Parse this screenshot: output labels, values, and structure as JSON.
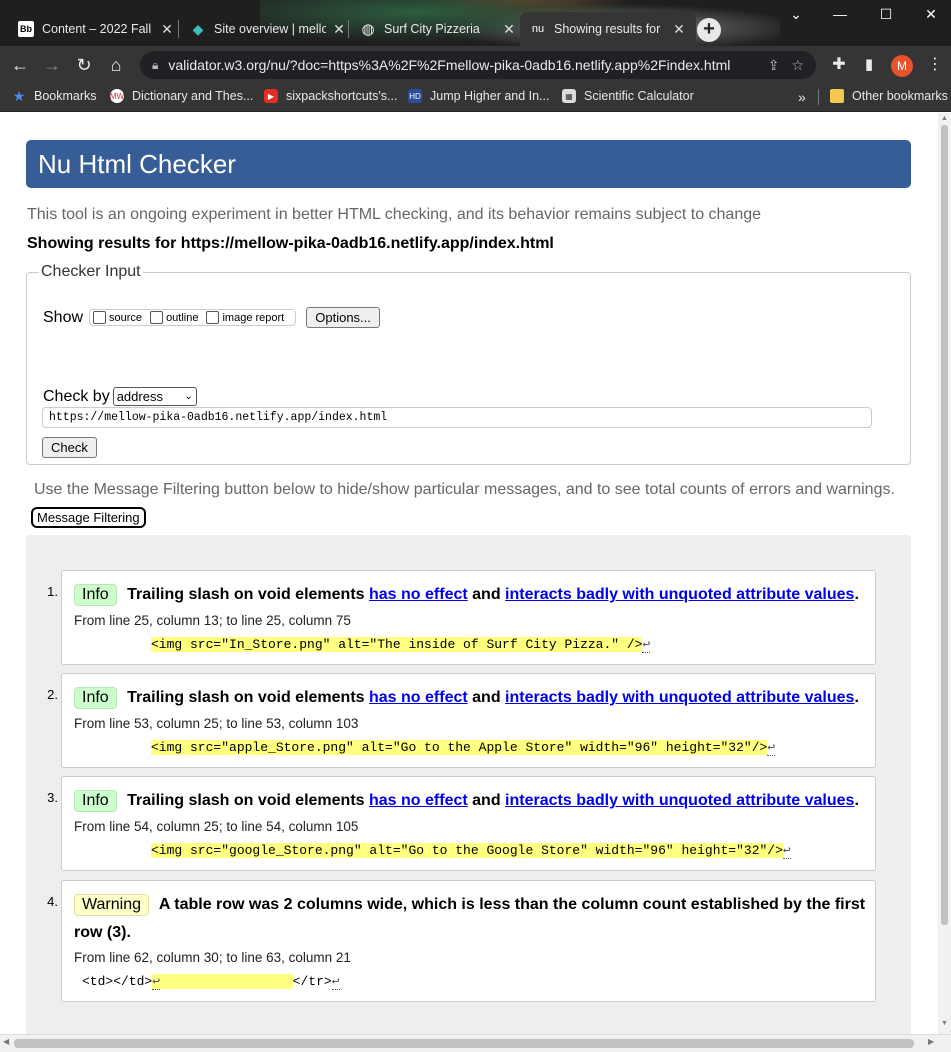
{
  "browser": {
    "tabs": [
      {
        "icon": "Bb",
        "label": "Content – 2022 Fall",
        "close": "✕"
      },
      {
        "icon": "◆",
        "label": "Site overview | mellow",
        "close": "✕"
      },
      {
        "icon": "◍",
        "label": "Surf City Pizzeria",
        "close": "✕"
      },
      {
        "icon": "nu",
        "label": "Showing results for",
        "close": "✕"
      }
    ],
    "new_tab": "+",
    "window_controls": [
      "⌄",
      "—",
      "☐",
      "✕"
    ],
    "url": "validator.w3.org/nu/?doc=https%3A%2F%2Fmellow-pika-0adb16.netlify.app%2Findex.html",
    "profile_initial": "M",
    "bookmarks": [
      {
        "label": "Bookmarks"
      },
      {
        "label": "Dictionary and Thes..."
      },
      {
        "label": "sixpackshortcuts's..."
      },
      {
        "label": "Jump Higher and In..."
      },
      {
        "label": "Scientific Calculator"
      }
    ],
    "bookmarks_overflow": "»",
    "other_bookmarks": "Other bookmarks"
  },
  "page": {
    "title": "Nu Html Checker",
    "intro": "This tool is an ongoing experiment in better HTML checking, and its behavior remains subject to change",
    "showing": "Showing results for https://mellow-pika-0adb16.netlify.app/index.html",
    "checker": {
      "legend": "Checker Input",
      "show_label": "Show",
      "options": [
        "source",
        "outline",
        "image report"
      ],
      "options_button": "Options...",
      "check_by_label": "Check by",
      "check_by_value": "address",
      "url_value": "https://mellow-pika-0adb16.netlify.app/index.html",
      "check_button": "Check"
    },
    "filter_hint": "Use the Message Filtering button below to hide/show particular messages, and to see total counts of errors and warnings.",
    "filter_button": "Message Filtering",
    "messages": [
      {
        "num": "1.",
        "type": "Info",
        "text_before": "Trailing slash on void elements",
        "link1": "has no effect",
        "text_mid": "and",
        "link2": "interacts badly with unquoted attribute values",
        "text_after": ".",
        "location": "From line 25, column 13; to line 25, column 75",
        "code": "<img src=\"In_Store.png\" alt=\"The inside of Surf City Pizza.\" />",
        "return_symbol": "↩"
      },
      {
        "num": "2.",
        "type": "Info",
        "text_before": "Trailing slash on void elements",
        "link1": "has no effect",
        "text_mid": "and",
        "link2": "interacts badly with unquoted attribute values",
        "text_after": ".",
        "location": "From line 53, column 25; to line 53, column 103",
        "code": "<img src=\"apple_Store.png\" alt=\"Go to the Apple Store\" width=\"96\" height=\"32\"/>",
        "return_symbol": "↩"
      },
      {
        "num": "3.",
        "type": "Info",
        "text_before": "Trailing slash on void elements",
        "link1": "has no effect",
        "text_mid": "and",
        "link2": "interacts badly with unquoted attribute values",
        "text_after": ".",
        "location": "From line 54, column 25; to line 54, column 105",
        "code": "<img src=\"google_Store.png\" alt=\"Go to the Google Store\" width=\"96\" height=\"32\"/>",
        "return_symbol": "↩"
      },
      {
        "num": "4.",
        "type": "Warning",
        "text": "A table row was 2 columns wide, which is less than the column count established by the first row (3).",
        "location": "From line 62, column 30; to line 63, column 21",
        "code_before": "<td></td>",
        "code_highlight": "                 ",
        "code_after": "</tr>",
        "return_symbol": "↩"
      }
    ]
  },
  "colors": {
    "header_bg": "#365d95",
    "info_badge": "#ccffcc",
    "warning_badge": "#ffffcc",
    "code_highlight": "#ffff80",
    "link": "#0000ee"
  }
}
